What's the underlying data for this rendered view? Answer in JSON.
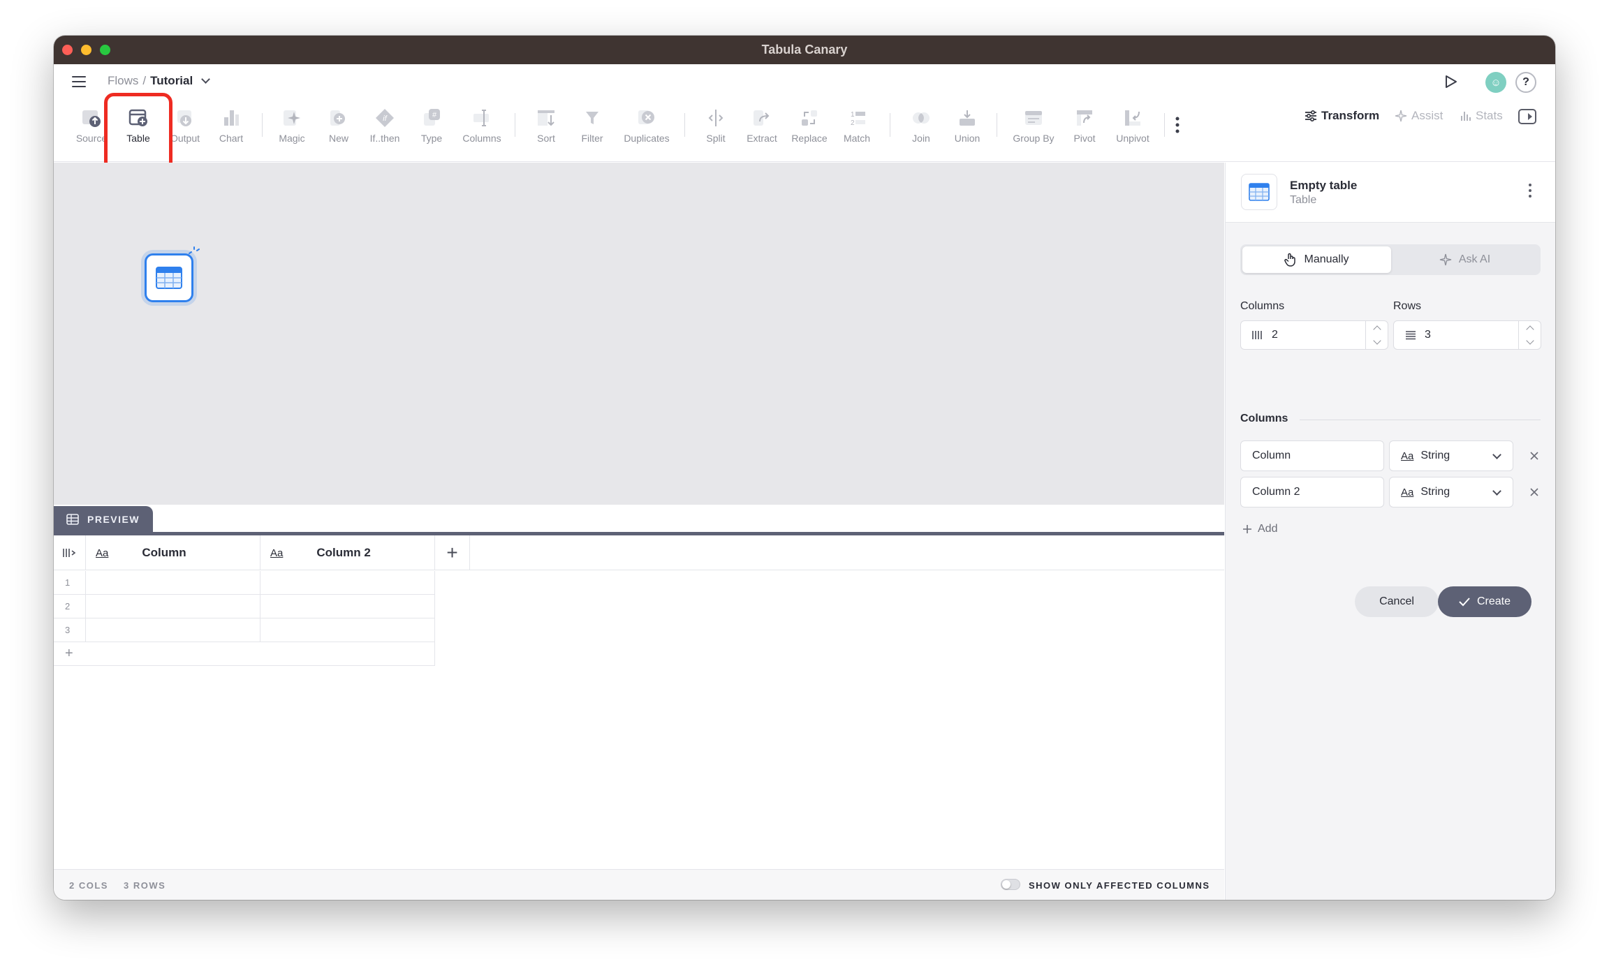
{
  "window": {
    "title": "Tabula Canary"
  },
  "breadcrumb": {
    "root": "Flows",
    "separator": "/",
    "current": "Tutorial"
  },
  "toolbar": {
    "items": [
      {
        "label": "Source",
        "icon": "source-icon"
      },
      {
        "label": "Table",
        "icon": "table-add-icon"
      },
      {
        "label": "Output",
        "icon": "output-icon"
      },
      {
        "label": "Chart",
        "icon": "chart-icon"
      },
      {
        "label": "Magic",
        "icon": "magic-icon"
      },
      {
        "label": "New",
        "icon": "new-column-icon"
      },
      {
        "label": "If..then",
        "icon": "if-then-icon"
      },
      {
        "label": "Type",
        "icon": "type-icon"
      },
      {
        "label": "Columns",
        "icon": "columns-icon"
      },
      {
        "label": "Sort",
        "icon": "sort-icon"
      },
      {
        "label": "Filter",
        "icon": "filter-icon"
      },
      {
        "label": "Duplicates",
        "icon": "duplicates-icon"
      },
      {
        "label": "Split",
        "icon": "split-icon"
      },
      {
        "label": "Extract",
        "icon": "extract-icon"
      },
      {
        "label": "Replace",
        "icon": "replace-icon"
      },
      {
        "label": "Match",
        "icon": "match-icon"
      },
      {
        "label": "Join",
        "icon": "join-icon"
      },
      {
        "label": "Union",
        "icon": "union-icon"
      },
      {
        "label": "Group By",
        "icon": "group-by-icon"
      },
      {
        "label": "Pivot",
        "icon": "pivot-icon"
      },
      {
        "label": "Unpivot",
        "icon": "unpivot-icon"
      }
    ]
  },
  "right_tabs": {
    "transform": "Transform",
    "assist": "Assist",
    "stats": "Stats"
  },
  "preview": {
    "tab_label": "PREVIEW",
    "columns": [
      {
        "type": "Aa",
        "name": "Column"
      },
      {
        "type": "Aa",
        "name": "Column 2"
      }
    ],
    "rows": [
      "1",
      "2",
      "3"
    ],
    "add_row": "+",
    "add_column": "+"
  },
  "status": {
    "cols": "2 COLS",
    "rows": "3 ROWS",
    "affected_toggle_label": "SHOW ONLY AFFECTED COLUMNS"
  },
  "panel": {
    "title": "Empty table",
    "subtitle": "Table",
    "mode_manual": "Manually",
    "mode_ai": "Ask AI",
    "columns_label": "Columns",
    "rows_label": "Rows",
    "columns_count": "2",
    "rows_count": "3",
    "columns_section": "Columns",
    "column_defs": [
      {
        "name": "Column",
        "type_abbr": "Aa",
        "type": "String"
      },
      {
        "name": "Column 2",
        "type_abbr": "Aa",
        "type": "String"
      }
    ],
    "add_label": "Add",
    "cancel_label": "Cancel",
    "create_label": "Create"
  },
  "colors": {
    "titlebar": "#3f3431",
    "accent": "#2f80ed",
    "primary_button": "#5d6175",
    "highlight": "#ee2b22"
  }
}
